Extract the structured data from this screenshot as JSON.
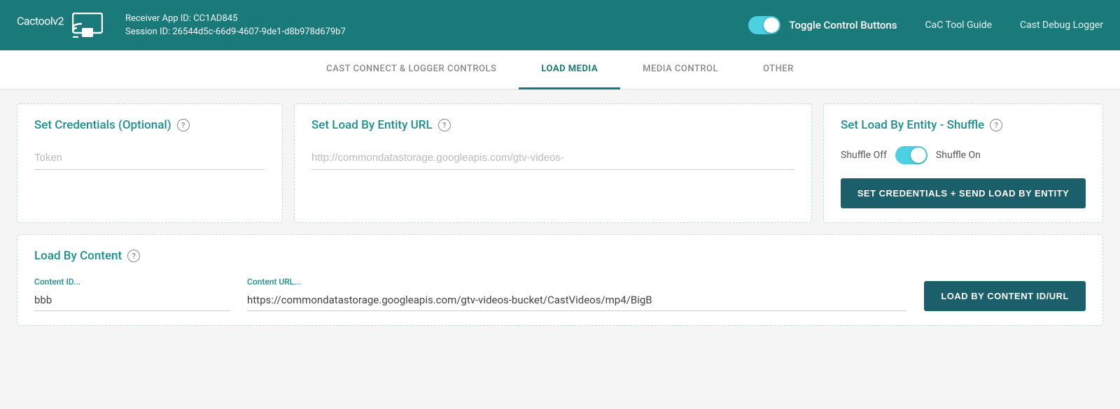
{
  "header": {
    "logo_text": "Cactool",
    "logo_version": "v2",
    "receiver_app_id_label": "Receiver App ID: CC1AD845",
    "session_id_label": "Session ID: 26544d5c-66d9-4607-9de1-d8b978d679b7",
    "toggle_label": "Toggle Control Buttons",
    "nav_links": [
      {
        "label": "CaC Tool Guide",
        "name": "cac-tool-guide-link"
      },
      {
        "label": "Cast Debug Logger",
        "name": "cast-debug-logger-link"
      }
    ]
  },
  "tabs": [
    {
      "label": "CAST CONNECT & LOGGER CONTROLS",
      "name": "tab-cast-connect",
      "active": false
    },
    {
      "label": "LOAD MEDIA",
      "name": "tab-load-media",
      "active": true
    },
    {
      "label": "MEDIA CONTROL",
      "name": "tab-media-control",
      "active": false
    },
    {
      "label": "OTHER",
      "name": "tab-other",
      "active": false
    }
  ],
  "cards": {
    "credentials": {
      "title": "Set Credentials (Optional)",
      "token_placeholder": "Token"
    },
    "entity_url": {
      "title": "Set Load By Entity URL",
      "url_placeholder": "http://commondatastorage.googleapis.com/gtv-videos-"
    },
    "shuffle": {
      "title": "Set Load By Entity - Shuffle",
      "shuffle_off_label": "Shuffle Off",
      "shuffle_on_label": "Shuffle On",
      "button_label": "SET CREDENTIALS + SEND LOAD BY ENTITY"
    },
    "load_content": {
      "title": "Load By Content",
      "content_id_label": "Content ID...",
      "content_id_value": "bbb",
      "content_url_label": "Content URL...",
      "content_url_value": "https://commondatastorage.googleapis.com/gtv-videos-bucket/CastVideos/mp4/BigB",
      "button_label": "LOAD BY CONTENT ID/URL"
    }
  },
  "icons": {
    "help": "?",
    "cast_icon": "cast"
  }
}
